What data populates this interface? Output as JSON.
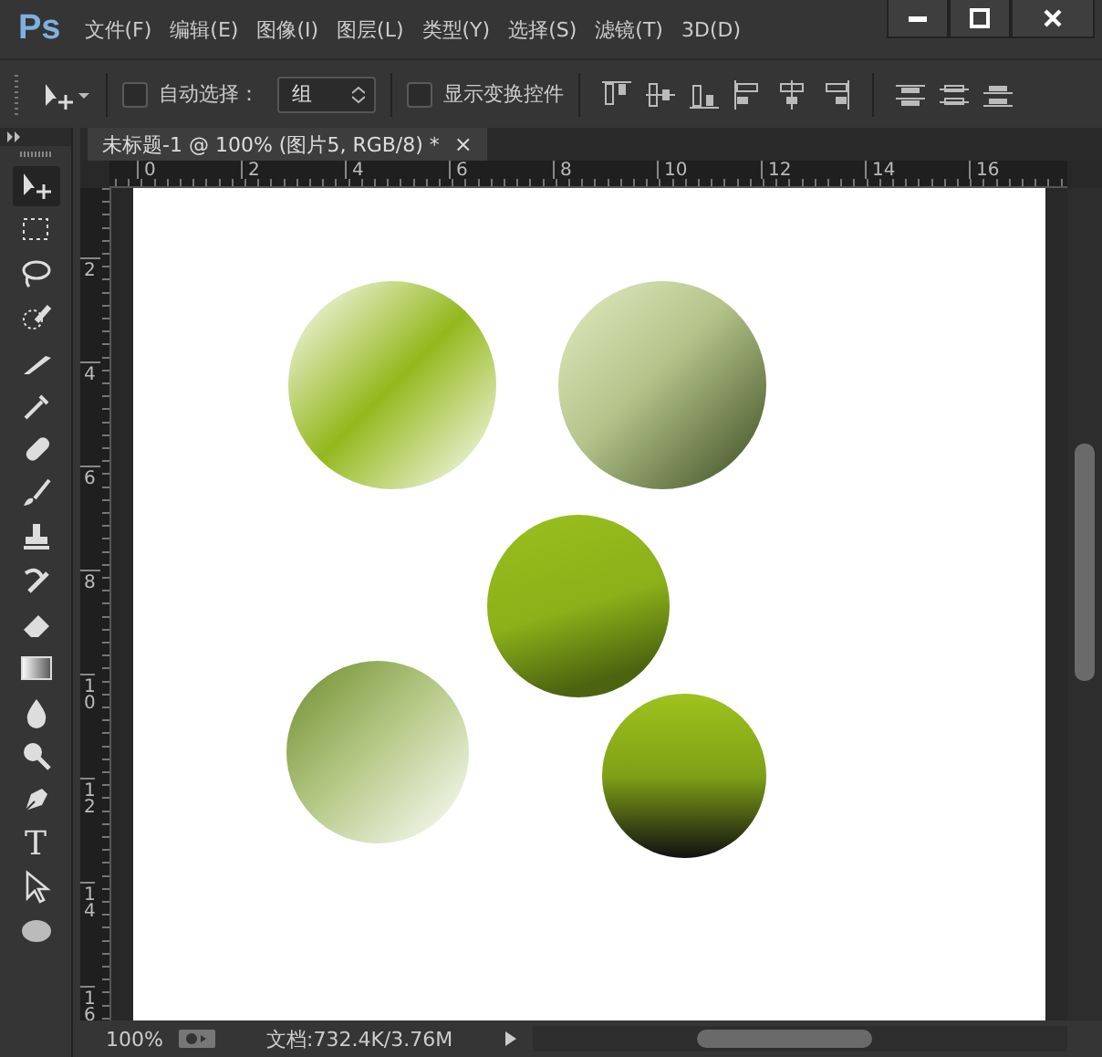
{
  "menu_bar": {
    "logo": "Ps",
    "items": [
      "文件(F)",
      "编辑(E)",
      "图像(I)",
      "图层(L)",
      "类型(Y)",
      "选择(S)",
      "滤镜(T)",
      "3D(D)"
    ]
  },
  "options_bar": {
    "auto_select": {
      "label": "自动选择：",
      "checked": false
    },
    "auto_select_target": {
      "value": "组"
    },
    "show_transform": {
      "label": "显示变换控件",
      "checked": false
    },
    "align_buttons": [
      {
        "kind": "top"
      },
      {
        "kind": "vcenter"
      },
      {
        "kind": "bottom"
      },
      {
        "kind": "left"
      },
      {
        "kind": "hcenter"
      },
      {
        "kind": "right"
      }
    ],
    "distribute_buttons": [
      {
        "kind": "top"
      },
      {
        "kind": "vcenter"
      },
      {
        "kind": "bottom"
      }
    ]
  },
  "tools": [
    {
      "kind": "move",
      "selected": true
    },
    {
      "kind": "marquee",
      "selected": false
    },
    {
      "kind": "lasso",
      "selected": false
    },
    {
      "kind": "quick_select",
      "selected": false
    },
    {
      "kind": "slice",
      "selected": false
    },
    {
      "kind": "eyedropper",
      "selected": false
    },
    {
      "kind": "healing",
      "selected": false
    },
    {
      "kind": "brush",
      "selected": false
    },
    {
      "kind": "stamp",
      "selected": false
    },
    {
      "kind": "history",
      "selected": false
    },
    {
      "kind": "eraser",
      "selected": false
    },
    {
      "kind": "gradient",
      "selected": false
    },
    {
      "kind": "blur",
      "selected": false
    },
    {
      "kind": "dodge",
      "selected": false
    },
    {
      "kind": "pen",
      "selected": false
    },
    {
      "kind": "type",
      "label": "T",
      "selected": false
    },
    {
      "kind": "path_select",
      "selected": false
    },
    {
      "kind": "ellipse",
      "selected": false
    }
  ],
  "document_tabs": [
    {
      "title": "未标题-1 @ 100% (图片5, RGB/8) *",
      "close": "×",
      "selected": true
    }
  ],
  "horizontal_ruler": [
    "0",
    "2",
    "4",
    "6",
    "8",
    "10",
    "12",
    "14",
    "16"
  ],
  "vertical_ruler": [
    "2",
    "4",
    "6",
    "8",
    "10",
    "12",
    "14",
    "16"
  ],
  "status_bar": {
    "zoom": "100%",
    "document_size": "文档:732.4K/3.76M"
  }
}
